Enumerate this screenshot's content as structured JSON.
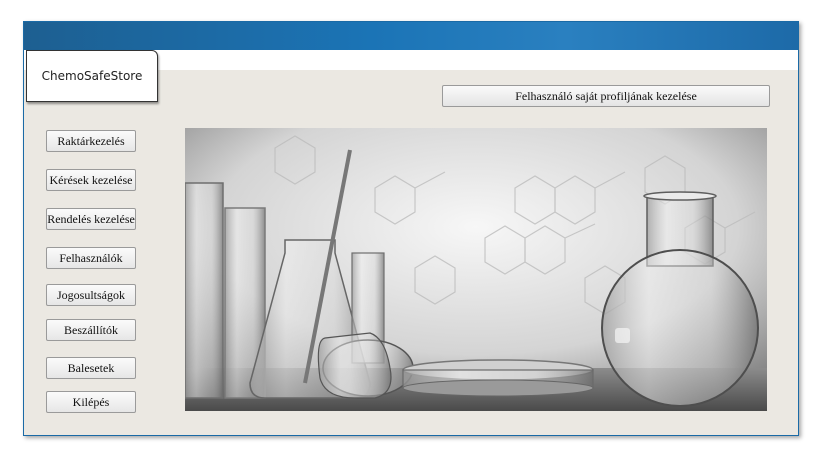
{
  "logo": {
    "text": "ChemoSafeStore"
  },
  "profile_button": {
    "label": "Felhasználó saját profiljának kezelése"
  },
  "nav": [
    {
      "label": "Raktárkezelés"
    },
    {
      "label": "Kérések kezelése"
    },
    {
      "label": "Rendelés kezelése"
    },
    {
      "label": "Felhasználók"
    },
    {
      "label": "Jogosultságok"
    },
    {
      "label": "Beszállítók"
    },
    {
      "label": "Balesetek"
    },
    {
      "label": "Kilépés"
    }
  ],
  "image": {
    "subject": "laboratory-glassware-photo"
  },
  "colors": {
    "titlebar": "#1b74b6",
    "background": "#ebe8e2",
    "border": "#1a6aa6"
  }
}
